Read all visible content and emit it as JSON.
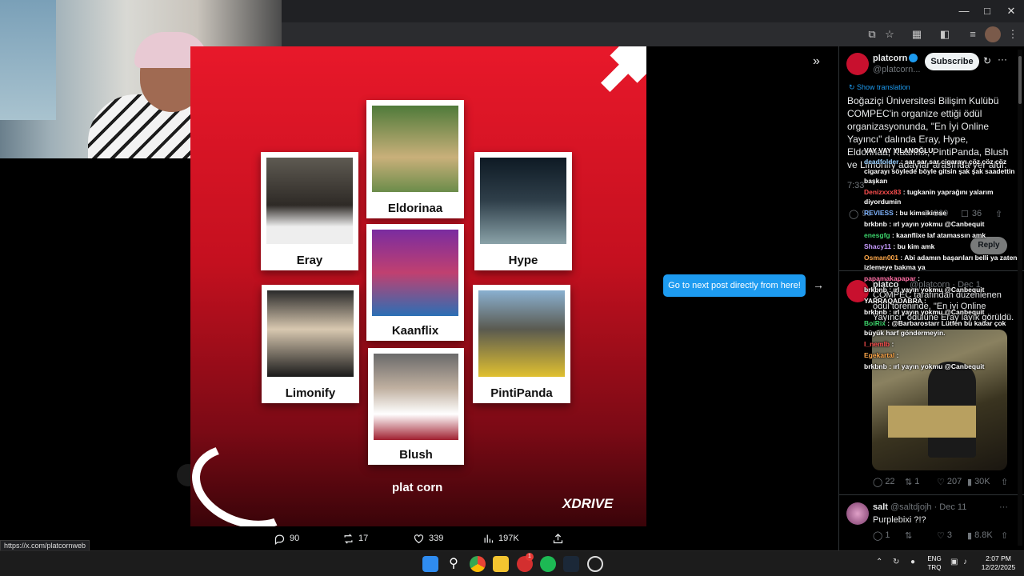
{
  "status_url": "https://x.com/platcornweb",
  "poster": {
    "people": [
      "Eldorinaa",
      "Eray",
      "Hype",
      "Kaanflix",
      "Limonify",
      "PintiPanda",
      "Blush"
    ],
    "logo_left": "plat corn",
    "logo_right": "XDRIVE"
  },
  "media_actions": {
    "replies": "90",
    "reposts": "17",
    "likes": "339",
    "views": "197K"
  },
  "next_tip": "Go to next post directly from here!",
  "sidebar": {
    "post": {
      "display_name": "platcorn",
      "handle": "@platcorn...",
      "subscribe_label": "Subscribe",
      "show_translation": "Show translation",
      "text": "Boğaziçi Üniversitesi Bilişim Kulübü COMPEC'in organize ettiği ödül organizasyonunda, \"En İyi Online Yayıncı\" dalında Eray, Hype, Eldorinaa, Kaanflix, PintiPanda, Blush ve Limonify adaylar arasında yer aldı.",
      "time": "7:33",
      "replies": "90",
      "likes": "339",
      "bookmarks": "36",
      "reply_label": "Reply"
    },
    "post2": {
      "name_fragment": "platco",
      "handle_fragment": "@platcorn · Dec 1",
      "text": "COMPEC tarafından düzenlenen ödül töreninde, \"En iyi Online Yayıncı\" ödülüne Eray layık görüldü.",
      "replies": "22",
      "reposts": "1",
      "likes": "207",
      "views": "30K"
    },
    "reply": {
      "name": "salt",
      "handle": "@saltdjojh · Dec 11",
      "text": "Purplebixi ?!?",
      "replies": "1",
      "likes": "3",
      "views": "8.8K"
    }
  },
  "chat": [
    {
      "user": "",
      "color": "#ffffff",
      "msg": "VAY VAY YILANOĞLU"
    },
    {
      "user": "deadfolder",
      "color": "#9ad0ff",
      "msg": ": sar sar sar cigarayı çöz çöz çöz cigarayı söylede böyle gitsin şak şak saadettin başkan"
    },
    {
      "user": "Denizxxx83",
      "color": "#ff4f4f",
      "msg": ": tugkanin yaprağını yalarım diyordumin"
    },
    {
      "user": "REVIESS",
      "color": "#7fb4ff",
      "msg": ": bu kimsikimse"
    },
    {
      "user": "brkbnb",
      "color": "#ffffff",
      "msg": ": ırl yayın yokmu @Canbequit"
    },
    {
      "user": "enesgfg",
      "color": "#3cd46b",
      "msg": ": kaanflixe laf atamassın amk"
    },
    {
      "user": "Shacy11",
      "color": "#c79bff",
      "msg": ": bu kim amk"
    },
    {
      "user": "Osman001",
      "color": "#ffa84a",
      "msg": ": Abi adamın başarıları belli ya zaten izlemeye bakma ya"
    },
    {
      "user": "papamakapapar",
      "color": "#ff6fa5",
      "msg": ":"
    },
    {
      "user": "brkbnb",
      "color": "#ffffff",
      "msg": ": ırl yayın yokmu @Canbequit"
    },
    {
      "user": "YARRAQADABRA",
      "color": "#ffffff",
      "msg": ":"
    },
    {
      "user": "brkbnb",
      "color": "#ffffff",
      "msg": ": ırl yayın yokmu @Canbequit"
    },
    {
      "user": "BoiRix",
      "color": "#3cd46b",
      "msg": ": @Barbarostarr Lütfen bu kadar çok büyük harf göndermeyin."
    },
    {
      "user": "l_nemlb",
      "color": "#ff4f4f",
      "msg": ":"
    },
    {
      "user": "Egekartal",
      "color": "#ffa84a",
      "msg": ":"
    },
    {
      "user": "brkbnb",
      "color": "#ffffff",
      "msg": ": ırl yayın yokmu @Canbequit"
    }
  ],
  "taskbar": {
    "lang": "ENG",
    "lang2": "TRQ",
    "time": "2:07 PM",
    "date": "12/22/2025",
    "notification_badge": "1"
  }
}
